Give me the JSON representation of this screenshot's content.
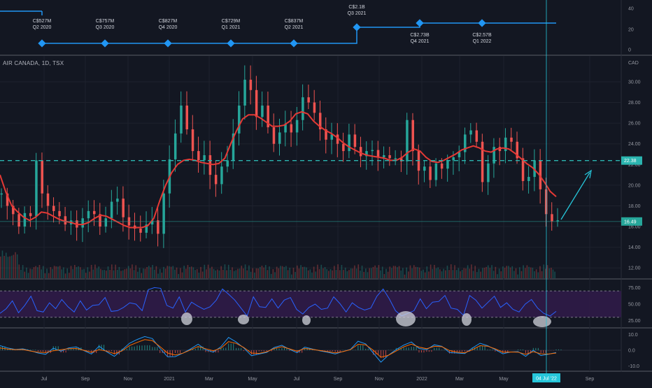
{
  "header": {
    "symbol_line": "AIR CANADA, 1D, TSX",
    "currency": "CAD"
  },
  "colors": {
    "background": "#131722",
    "up": "#26a69a",
    "down": "#ef5350",
    "ma": "#e53935",
    "accent": "#2196f3",
    "rsi_line": "#2962ff",
    "rsi_band": "#311b4a",
    "level_line": "#2bb5b0",
    "arrow": "#26c6da",
    "crosshair": "#26c6da",
    "macd": "#2196f3",
    "signal": "#ff6d00"
  },
  "fundamentals": {
    "axis_ticks": [
      "40",
      "20",
      "0"
    ],
    "points": [
      {
        "value": "C$527M",
        "period": "Q2 2020",
        "amount": 527
      },
      {
        "value": "C$757M",
        "period": "Q3 2020",
        "amount": 757
      },
      {
        "value": "C$827M",
        "period": "Q4 2020",
        "amount": 827
      },
      {
        "value": "C$729M",
        "period": "Q1 2021",
        "amount": 729
      },
      {
        "value": "C$837M",
        "period": "Q2 2021",
        "amount": 837
      },
      {
        "value": "C$2.1B",
        "period": "Q3 2021",
        "amount": 2100
      },
      {
        "value": "C$2.73B",
        "period": "Q4 2021",
        "amount": 2730
      },
      {
        "value": "C$2.57B",
        "period": "Q1 2022",
        "amount": 2570
      }
    ]
  },
  "chart_data": [
    {
      "type": "candlestick",
      "title": "AIR CANADA, 1D, TSX",
      "y_unit": "CAD",
      "ylim": [
        11,
        32.5
      ],
      "y_ticks": [
        12,
        14,
        16,
        18,
        20,
        22,
        24,
        26,
        28,
        30
      ],
      "y_tick_labels": [
        "12.00",
        "14.00",
        "16.00",
        "18.00",
        "20.00",
        "22.00",
        "24.00",
        "26.00",
        "28.00",
        "30.00"
      ],
      "x_ticks": [
        "Jul",
        "Sep",
        "Nov",
        "2021",
        "Mar",
        "May",
        "Jul",
        "Sep",
        "Nov",
        "2022",
        "Mar",
        "May",
        "Jul",
        "Sep"
      ],
      "current_price": 16.49,
      "current_price_label": "16.49",
      "horizontal_level": 22.38,
      "horizontal_level_label": "22.38",
      "crosshair_date": "04 Jul '22",
      "series": [
        {
          "name": "Close",
          "values": [
            19.2,
            18.0,
            17.2,
            16.0,
            17.3,
            17.0,
            22.4,
            19.2,
            18.0,
            17.5,
            17.0,
            16.2,
            16.6,
            15.9,
            16.8,
            17.5,
            17.2,
            16.0,
            16.8,
            18.4,
            18.7,
            16.9,
            16.1,
            15.8,
            15.4,
            16.2,
            16.6,
            15.3,
            19.2,
            22.5,
            25.0,
            27.7,
            25.4,
            23.3,
            22.4,
            22.9,
            21.0,
            20.1,
            21.8,
            22.4,
            25.0,
            27.7,
            30.2,
            29.2,
            26.6,
            27.7,
            25.6,
            24.0,
            25.1,
            25.9,
            25.1,
            26.3,
            28.5,
            28.0,
            27.0,
            25.4,
            24.4,
            24.9,
            24.0,
            23.3,
            24.9,
            23.7,
            22.8,
            23.3,
            23.4,
            22.7,
            22.9,
            22.6,
            22.6,
            22.3,
            26.3,
            23.3,
            21.4,
            21.8,
            20.5,
            22.1,
            21.6,
            22.4,
            22.7,
            23.2,
            24.9,
            25.3,
            24.2,
            20.3,
            22.1,
            23.7,
            23.3,
            24.6,
            24.2,
            22.6,
            20.4,
            20.8,
            22.4,
            19.6,
            17.2,
            16.5,
            16.6
          ]
        },
        {
          "name": "Moving Average",
          "values": [
            21.0,
            19.3,
            18.0,
            17.4,
            16.9,
            16.6,
            16.9,
            17.4,
            17.3,
            17.0,
            16.7,
            16.5,
            16.4,
            16.2,
            16.2,
            16.4,
            16.8,
            17.1,
            17.0,
            16.7,
            16.4,
            16.1,
            15.9,
            15.9,
            15.9,
            16.1,
            16.8,
            18.5,
            20.0,
            21.2,
            22.0,
            22.4,
            22.5,
            22.4,
            22.2,
            22.1,
            22.0,
            22.1,
            22.6,
            24.0,
            25.3,
            26.4,
            26.8,
            26.8,
            26.5,
            26.1,
            25.7,
            25.7,
            25.8,
            26.2,
            26.9,
            27.1,
            26.9,
            26.2,
            25.7,
            25.3,
            25.0,
            24.6,
            24.1,
            23.7,
            23.4,
            23.1,
            22.9,
            22.8,
            22.7,
            22.6,
            22.4,
            22.4,
            22.7,
            23.2,
            23.5,
            23.3,
            22.7,
            22.3,
            22.2,
            22.4,
            22.7,
            23.0,
            23.4,
            23.6,
            23.8,
            23.6,
            23.3,
            23.2,
            23.5,
            23.6,
            23.5,
            23.1,
            22.6,
            22.1,
            21.7,
            21.1,
            20.3,
            19.4,
            18.9
          ]
        }
      ]
    },
    {
      "type": "line",
      "title": "RSI",
      "ylim": [
        15,
        85
      ],
      "y_ticks": [
        25,
        50,
        75
      ],
      "y_tick_labels": [
        "25.00",
        "50.00",
        "75.00"
      ],
      "band": [
        30,
        70
      ],
      "series": [
        {
          "name": "RSI",
          "values": [
            36,
            43,
            55,
            37,
            48,
            62,
            40,
            38,
            52,
            43,
            57,
            46,
            38,
            55,
            41,
            48,
            49,
            60,
            39,
            40,
            45,
            52,
            50,
            40,
            72,
            75,
            74,
            48,
            44,
            61,
            38,
            53,
            47,
            42,
            46,
            56,
            73,
            65,
            56,
            44,
            32,
            61,
            46,
            45,
            58,
            44,
            56,
            60,
            42,
            35,
            45,
            50,
            42,
            44,
            61,
            51,
            38,
            52,
            45,
            41,
            44,
            62,
            73,
            58,
            40,
            32,
            36,
            40,
            58,
            43,
            53,
            54,
            63,
            44,
            42,
            33,
            63,
            56,
            44,
            53,
            62,
            45,
            52,
            42,
            38,
            50,
            57,
            44,
            36,
            32,
            39
          ]
        }
      ]
    },
    {
      "type": "line",
      "title": "MACD",
      "ylim": [
        -13,
        13
      ],
      "y_ticks": [
        -10,
        0,
        10
      ],
      "y_tick_labels": [
        "-10.0",
        "0.0",
        "10.0"
      ],
      "series": [
        {
          "name": "MACD",
          "values": [
            3.0,
            1.5,
            0.5,
            0.9,
            -0.3,
            -1.8,
            -2.6,
            1.3,
            -0.6,
            1.5,
            2.2,
            -0.2,
            -2.4,
            2.6,
            -1.0,
            -3.9,
            0.1,
            4.5,
            6.9,
            8.8,
            7.5,
            1.2,
            -4.2,
            -4.1,
            -1.9,
            0.8,
            3.9,
            0.3,
            -1.2,
            2.3,
            8.2,
            5.3,
            1.5,
            -3.5,
            -2.4,
            -1.4,
            1.8,
            3.2,
            0.6,
            -1.6,
            2.0,
            0.8,
            -0.4,
            -1.3,
            -2.4,
            -0.8,
            0.6,
            5.8,
            4.1,
            -1.8,
            -7.6,
            -3.1,
            0.4,
            3.3,
            5.3,
            1.1,
            0.4,
            3.5,
            2.5,
            -1.5,
            -1.8,
            -2.1,
            1.4,
            4.5,
            2.9,
            0.4,
            -2.3,
            -1.1,
            -0.9,
            -3.9,
            0.0,
            -3.4,
            -2.5,
            -1.5
          ]
        },
        {
          "name": "Signal",
          "values": [
            1.5,
            0.8,
            0.4,
            0.5,
            -0.5,
            -1.3,
            -1.5,
            -0.3,
            0.3,
            1.0,
            1.1,
            0.0,
            -1.3,
            0.4,
            -0.6,
            -2.2,
            -0.5,
            3.0,
            5.0,
            6.8,
            6.2,
            2.3,
            -1.8,
            -3.0,
            -1.9,
            0.2,
            2.4,
            1.0,
            -0.3,
            1.3,
            5.5,
            4.4,
            1.8,
            -1.8,
            -2.0,
            -1.0,
            1.1,
            2.3,
            0.9,
            -0.6,
            1.1,
            0.6,
            -0.2,
            -0.9,
            -1.7,
            -0.9,
            0.4,
            3.8,
            3.5,
            0.0,
            -4.5,
            -3.2,
            -0.5,
            2.2,
            3.9,
            2.0,
            1.0,
            2.5,
            2.3,
            -0.2,
            -1.2,
            -1.6,
            0.3,
            2.9,
            2.6,
            0.9,
            -1.2,
            -1.1,
            -1.2,
            -2.6,
            -0.9,
            -2.3,
            -2.4,
            -1.8
          ]
        }
      ]
    }
  ]
}
